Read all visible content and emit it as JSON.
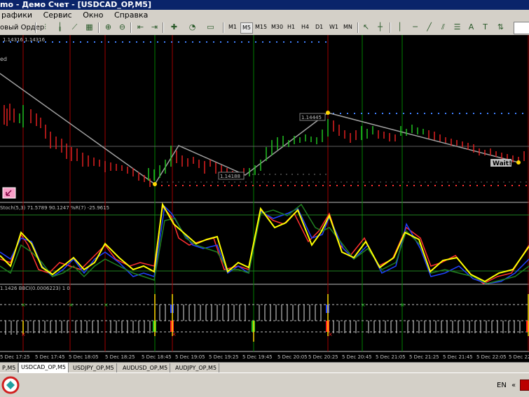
{
  "window": {
    "title": "mo - Демо Счет - [USDCAD_OP,M5]"
  },
  "menu": {
    "items": [
      "рафики",
      "Сервис",
      "Окно",
      "Справка"
    ]
  },
  "toolbar": {
    "new_order": "овый Ордер",
    "timeframes": [
      "M1",
      "M5",
      "M15",
      "M30",
      "H1",
      "H4",
      "D1",
      "W1",
      "MN"
    ],
    "selected_timeframe": "M5",
    "text_tool": "A"
  },
  "chart": {
    "price_info": "1.14316 1.14316",
    "indicator_label_main": "ed",
    "price_label_high": "1.14445",
    "price_label_low": "1.14188",
    "signal_label": "Wait!",
    "stoch_label": "Stoch(5,3) 71.5789 90.1247 %R(7) -25.9615",
    "bbci_label": "1.1426  BBCI(0.0006223) 1 0",
    "time_labels": [
      "5 Dec 17:25",
      "5 Dec 17:45",
      "5 Dec 18:05",
      "5 Dec 18:25",
      "5 Dec 18:45",
      "5 Dec 19:05",
      "5 Dec 19:25",
      "5 Dec 19:45",
      "5 Dec 20:05",
      "5 Dec 20:25",
      "5 Dec 20:45",
      "5 Dec 21:05",
      "5 Dec 21:25",
      "5 Dec 21:45",
      "5 Dec 22:05",
      "5 Dec 22"
    ]
  },
  "tabs": {
    "items": [
      "P,M5",
      "USDCAD_OP,M5",
      "USDJPY_OP,M5",
      "AUDUSD_OP,M5",
      "AUDJPY_OP,M5"
    ],
    "active": "USDCAD_OP,M5"
  },
  "statusbar": {
    "language": "EN",
    "tray_arrow": "«"
  }
}
